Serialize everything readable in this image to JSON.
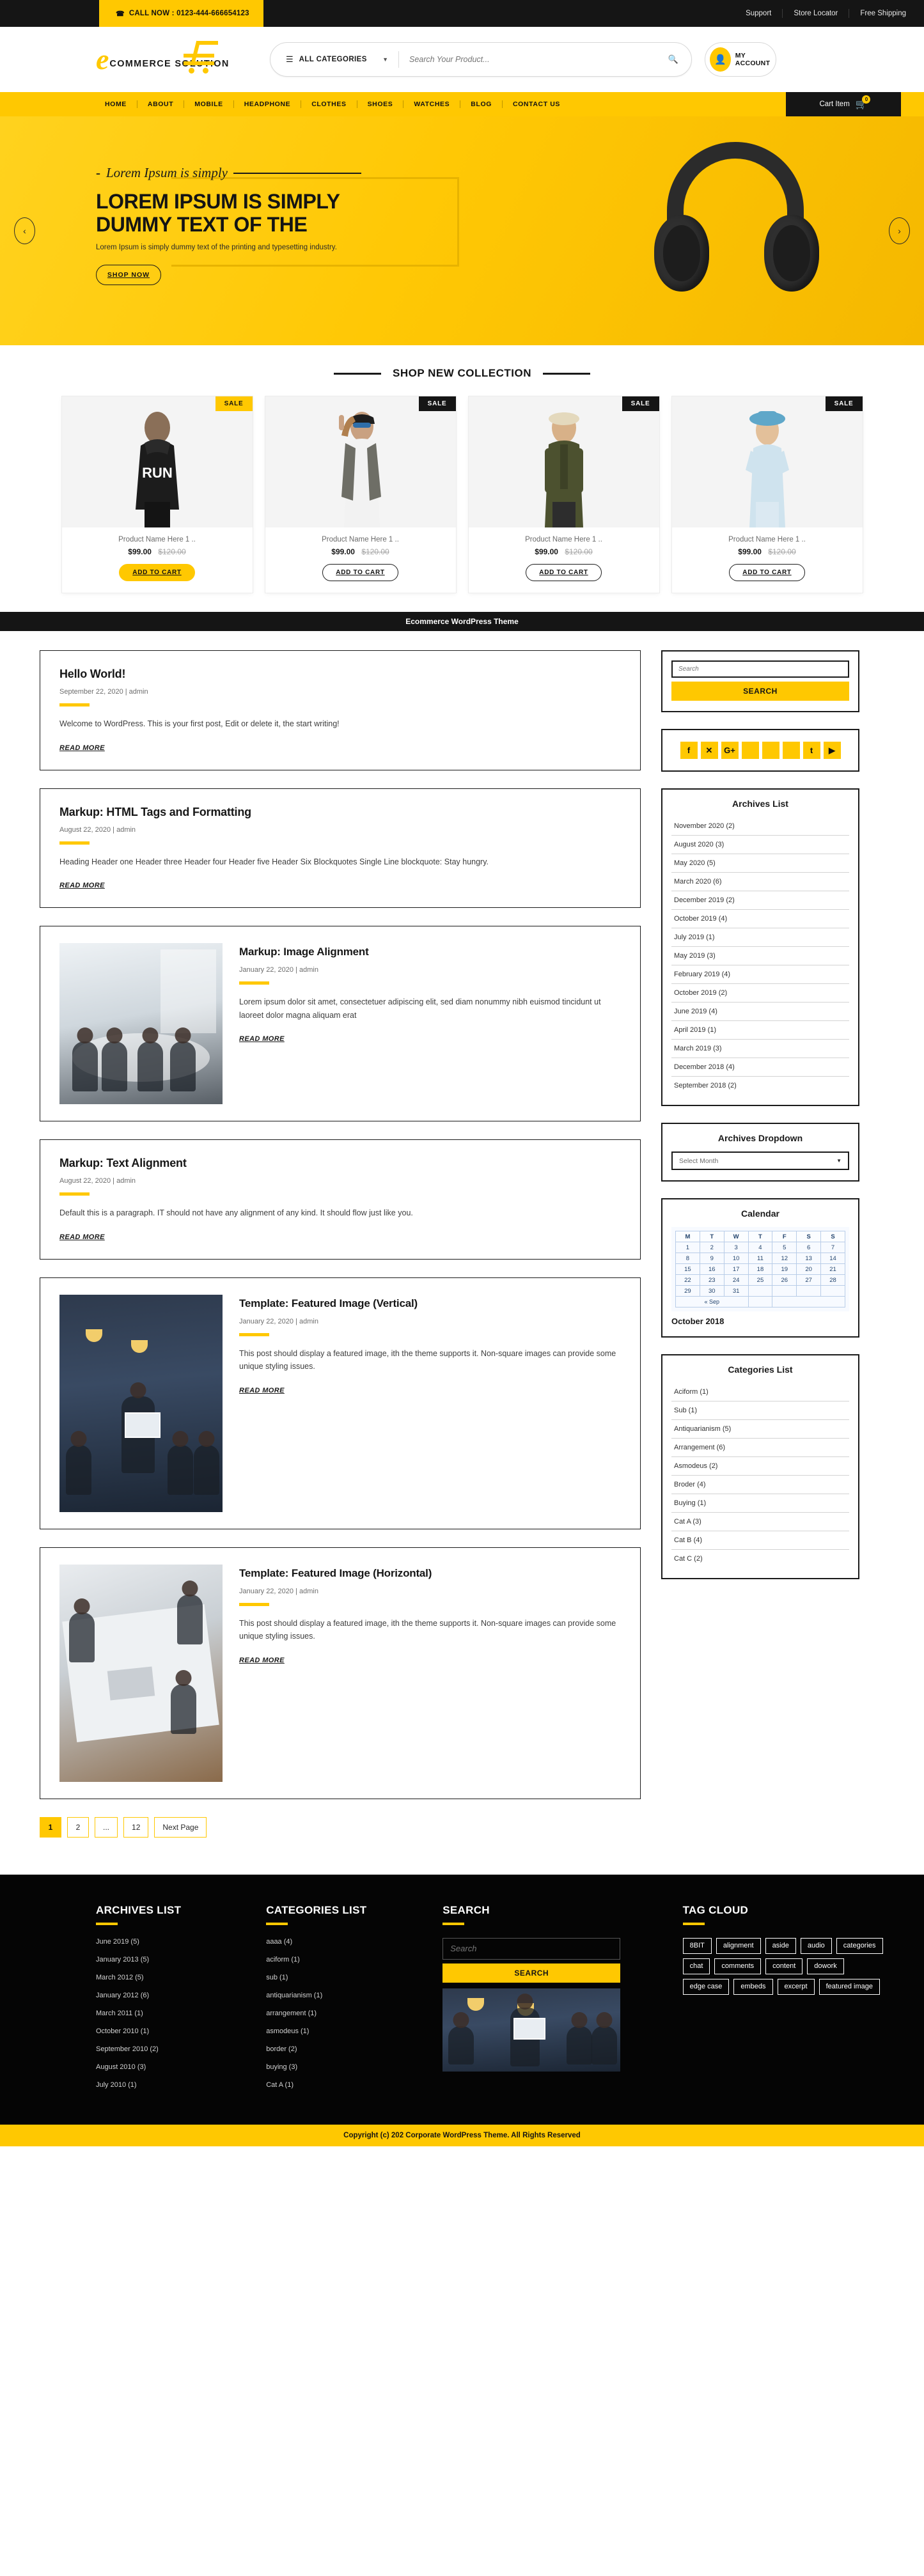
{
  "topbar": {
    "phone_icon": "phone-icon",
    "phone": "CALL NOW : 0123-444-666654123",
    "links": [
      "Support",
      "Store Locator",
      "Free Shipping"
    ]
  },
  "header": {
    "logo_mark": "e",
    "logo_text": "COMMERCE SOLUTION",
    "categories_label": "ALL CATEGORIES",
    "search_placeholder": "Search Your Product...",
    "search_value": "",
    "account_label": "MY ACCOUNT"
  },
  "nav": {
    "items": [
      "HOME",
      "ABOUT",
      "MOBILE",
      "HEADPHONE",
      "CLOTHES",
      "SHOES",
      "WATCHES",
      "BLOG",
      "CONTACT US"
    ],
    "cart_label": "Cart Item",
    "cart_count": "0"
  },
  "hero": {
    "script_text": "Lorem Ipsum is simply",
    "heading_line1": "LOREM IPSUM IS SIMPLY",
    "heading_line2": "DUMMY TEXT OF THE",
    "subtext": "Lorem Ipsum is simply dummy text of the printing and typesetting industry.",
    "button": "SHOP NOW",
    "prev_icon": "chevron-left-icon",
    "next_icon": "chevron-right-icon"
  },
  "collection": {
    "title": "SHOP NEW COLLECTION",
    "products": [
      {
        "name": "Product Name Here 1 ..",
        "price": "$99.00",
        "old_price": "$120.00",
        "badge": "SALE",
        "badge_style": "yellow",
        "cta": "ADD TO CART",
        "cta_style": "filled"
      },
      {
        "name": "Product Name Here 1 ..",
        "price": "$99.00",
        "old_price": "$120.00",
        "badge": "SALE",
        "badge_style": "black",
        "cta": "ADD TO CART",
        "cta_style": "outline"
      },
      {
        "name": "Product Name Here 1 ..",
        "price": "$99.00",
        "old_price": "$120.00",
        "badge": "SALE",
        "badge_style": "black",
        "cta": "ADD TO CART",
        "cta_style": "outline"
      },
      {
        "name": "Product Name Here 1 ..",
        "price": "$99.00",
        "old_price": "$120.00",
        "badge": "SALE",
        "badge_style": "black",
        "cta": "ADD TO CART",
        "cta_style": "outline"
      }
    ]
  },
  "themebar": {
    "text": "Ecommerce WordPress Theme"
  },
  "posts": [
    {
      "title": "Hello World!",
      "meta": "September 22, 2020 | admin",
      "excerpt": "Welcome to WordPress. This is your first post, Edit or delete it, the start writing!",
      "read_more": "READ MORE",
      "layout": "text"
    },
    {
      "title": "Markup: HTML Tags and Formatting",
      "meta": "August 22, 2020 | admin",
      "excerpt": "Heading Header one Header three Header four Header five Header Six Blockquotes Single Line blockquote: Stay hungry.",
      "read_more": "READ MORE",
      "layout": "text"
    },
    {
      "title": "Markup: Image Alignment",
      "meta": "January 22, 2020 | admin",
      "excerpt": "Lorem ipsum dolor sit amet, consectetuer adipiscing elit, sed diam nonummy nibh euismod tincidunt ut laoreet dolor magna aliquam erat",
      "read_more": "READ MORE",
      "layout": "media",
      "image_alt": "office-meeting-photo"
    },
    {
      "title": "Markup: Text Alignment",
      "meta": "August 22, 2020 | admin",
      "excerpt": "Default this is a paragraph. IT should not have any alignment of any kind. It should flow just like you.",
      "read_more": "READ MORE",
      "layout": "text"
    },
    {
      "title": "Template: Featured Image (Vertical)",
      "meta": "January 22, 2020 | admin",
      "excerpt": "This post should display a featured image, ith the theme supports it. Non-square images can provide some unique styling issues.",
      "read_more": "READ MORE",
      "layout": "media",
      "image_alt": "presentation-meeting-photo"
    },
    {
      "title": "Template: Featured Image (Horizontal)",
      "meta": "January 22, 2020 | admin",
      "excerpt": "This post should display a featured image, ith the theme supports it. Non-square images can provide some unique styling issues.",
      "read_more": "READ MORE",
      "layout": "media",
      "image_alt": "handshake-desk-photo"
    }
  ],
  "pagination": {
    "pages": [
      "1",
      "2",
      "...",
      "12",
      "Next Page"
    ],
    "active": "1"
  },
  "sidebar": {
    "search": {
      "placeholder": "Search",
      "value": "",
      "button": "SEARCH"
    },
    "socials": [
      {
        "name": "facebook-icon",
        "glyph": "f"
      },
      {
        "name": "twitter-x-icon",
        "glyph": "✕"
      },
      {
        "name": "google-plus-icon",
        "glyph": "G+"
      },
      {
        "name": "social-icon-4",
        "glyph": ""
      },
      {
        "name": "social-icon-5",
        "glyph": ""
      },
      {
        "name": "social-icon-6",
        "glyph": ""
      },
      {
        "name": "tumblr-icon",
        "glyph": "t"
      },
      {
        "name": "youtube-icon",
        "glyph": "▶"
      }
    ],
    "archives": {
      "title": "Archives List",
      "items": [
        "November 2020 (2)",
        "August 2020 (3)",
        "May 2020 (5)",
        "March 2020 (6)",
        "December 2019 (2)",
        "October 2019 (4)",
        "July 2019 (1)",
        "May 2019 (3)",
        "February 2019 (4)",
        "October 2019 (2)",
        "June 2019 (4)",
        "April 2019 (1)",
        "March 2019 (3)",
        "December 2018 (4)",
        "September 2018 (2)"
      ]
    },
    "archives_dropdown": {
      "title": "Archives Dropdown",
      "selected": "Select Month"
    },
    "calendar": {
      "title": "Calendar",
      "weekdays": [
        "M",
        "T",
        "W",
        "T",
        "F",
        "S",
        "S"
      ],
      "weeks": [
        [
          "1",
          "2",
          "3",
          "4",
          "5",
          "6",
          "7"
        ],
        [
          "8",
          "9",
          "10",
          "11",
          "12",
          "13",
          "14"
        ],
        [
          "15",
          "16",
          "17",
          "18",
          "19",
          "20",
          "21"
        ],
        [
          "22",
          "23",
          "24",
          "25",
          "26",
          "27",
          "28"
        ],
        [
          "29",
          "30",
          "31",
          "",
          "",
          "",
          ""
        ]
      ],
      "prev_link": "« Sep",
      "month_label": "October 2018"
    },
    "categories": {
      "title": "Categories List",
      "items": [
        "Aciform (1)",
        "Sub (1)",
        "Antiquarianism (5)",
        "Arrangement (6)",
        "Asmodeus (2)",
        "Broder (4)",
        "Buying (1)",
        "Cat A (3)",
        "Cat B (4)",
        "Cat C (2)"
      ]
    }
  },
  "footer": {
    "archives": {
      "title": "ARCHIVES LIST",
      "items": [
        "June 2019 (5)",
        "January  2013 (5)",
        "March 2012 (5)",
        "January  2012 (6)",
        "March  2011 (1)",
        "October 2010 (1)",
        "September 2010 (2)",
        "August 2010 (3)",
        "July 2010 (1)"
      ]
    },
    "categories": {
      "title": "CATEGORIES LIST",
      "items": [
        "aaaa (4)",
        "aciform (1)",
        "sub (1)",
        "antiquarianism (1)",
        "arrangement (1)",
        "asmodeus (1)",
        "border (2)",
        "buying (3)",
        "Cat A (1)"
      ]
    },
    "search": {
      "title": "SEARCH",
      "placeholder": "Search",
      "value": "",
      "button": "SEARCH",
      "image_alt": "presentation-meeting-photo"
    },
    "tags": {
      "title": "TAG CLOUD",
      "items": [
        "8BIT",
        "alignment",
        "aside",
        "audio",
        "categories",
        "chat",
        "comments",
        "content",
        "dowork",
        "edge case",
        "embeds",
        "excerpt",
        "featured image"
      ]
    },
    "copyright": "Copyright (c) 202 Corporate WordPress Theme. All Rights Reserved"
  },
  "colors": {
    "accent": "#FFC801",
    "dark": "#151515",
    "body_text": "#3e3e3e"
  }
}
